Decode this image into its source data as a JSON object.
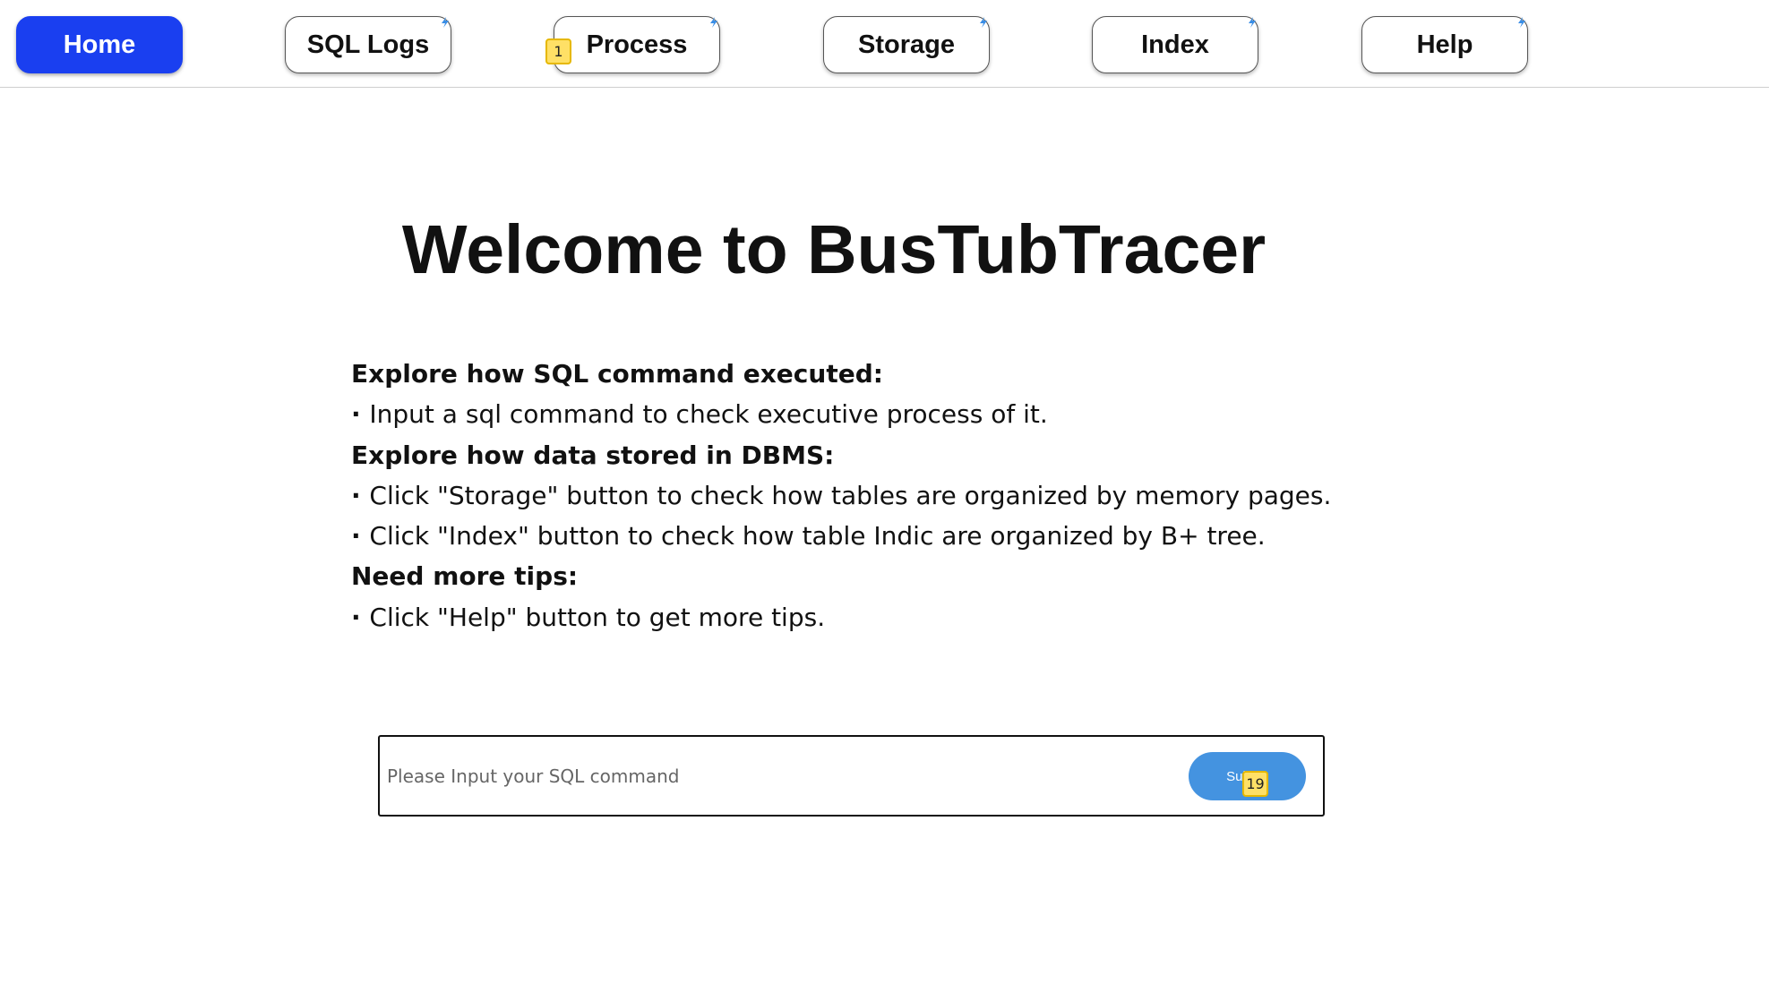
{
  "nav": {
    "items": [
      {
        "label": "Home",
        "active": true
      },
      {
        "label": "SQL Logs",
        "active": false
      },
      {
        "label": "Process",
        "active": false
      },
      {
        "label": "Storage",
        "active": false
      },
      {
        "label": "Index",
        "active": false
      },
      {
        "label": "Help",
        "active": false
      }
    ],
    "active_color": "#1a3ff0",
    "badge_icon": "bolt-icon"
  },
  "markers": {
    "process_marker": "1",
    "submit_marker": "19"
  },
  "main": {
    "title": "Welcome to BusTubTracer",
    "sections": [
      {
        "heading": "Explore how SQL command executed:",
        "bullets": [
          "Input a sql command to check executive process of it."
        ]
      },
      {
        "heading": "Explore how data stored in DBMS:",
        "bullets": [
          "Click \"Storage\" button to check how tables are organized by memory pages.",
          "Click \"Index\" button to check how table Indic are organized by B+ tree."
        ]
      },
      {
        "heading": "Need more tips:",
        "bullets": [
          "Click \"Help\" button to get more tips."
        ]
      }
    ]
  },
  "sql": {
    "placeholder": "Please Input your SQL command",
    "value": "",
    "submit_label": "Submit",
    "submit_color": "#4493e0"
  }
}
